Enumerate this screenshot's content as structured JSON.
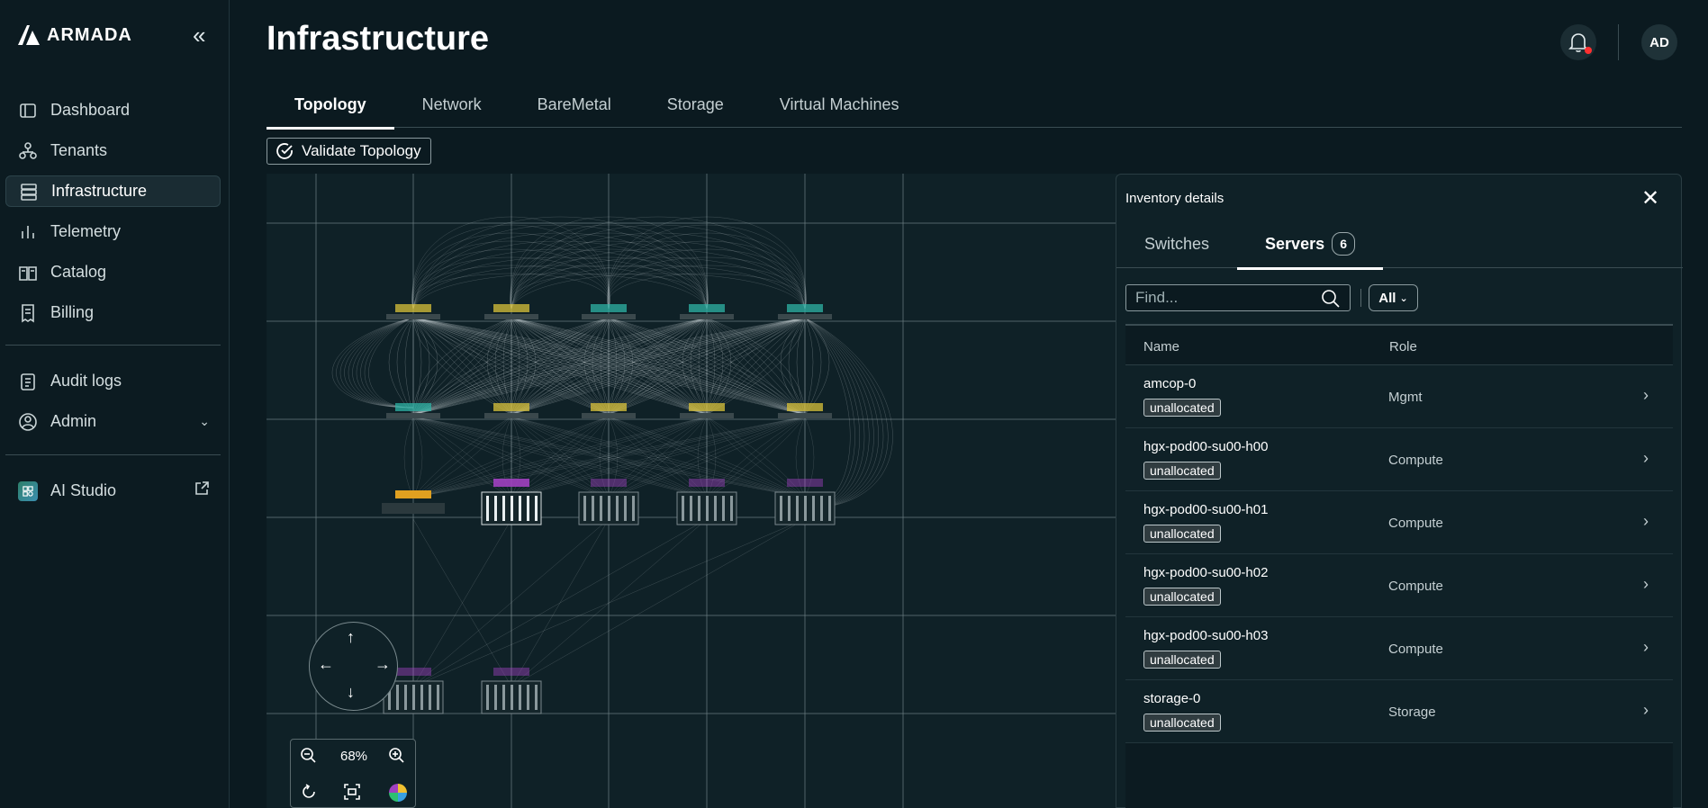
{
  "brand": {
    "name": "ARMADA",
    "collapse_icon": "double-chevron-left-icon"
  },
  "sidebar": {
    "items": [
      {
        "label": "Dashboard",
        "icon": "dashboard-icon",
        "active": false
      },
      {
        "label": "Tenants",
        "icon": "tenants-icon",
        "active": false
      },
      {
        "label": "Infrastructure",
        "icon": "server-stack-icon",
        "active": true
      },
      {
        "label": "Telemetry",
        "icon": "bar-chart-icon",
        "active": false
      },
      {
        "label": "Catalog",
        "icon": "book-icon",
        "active": false
      },
      {
        "label": "Billing",
        "icon": "receipt-icon",
        "active": false
      },
      {
        "label": "Audit logs",
        "icon": "clipboard-icon",
        "active": false
      },
      {
        "label": "Admin",
        "icon": "user-gear-icon",
        "active": false
      },
      {
        "label": "AI Studio",
        "icon": "ai-studio-icon",
        "active": false
      }
    ]
  },
  "header": {
    "title": "Infrastructure",
    "avatar_initials": "AD"
  },
  "tabs": [
    {
      "label": "Topology",
      "active": true
    },
    {
      "label": "Network",
      "active": false
    },
    {
      "label": "BareMetal",
      "active": false
    },
    {
      "label": "Storage",
      "active": false
    },
    {
      "label": "Virtual Machines",
      "active": false
    }
  ],
  "validate_button": {
    "label": "Validate Topology"
  },
  "zoom": {
    "level": "68%"
  },
  "panel": {
    "title": "Inventory details",
    "tabs": [
      {
        "label": "Switches",
        "active": false
      },
      {
        "label": "Servers",
        "active": true,
        "count": "6"
      }
    ],
    "search_placeholder": "Find...",
    "filter_value": "All",
    "columns": {
      "name": "Name",
      "role": "Role"
    },
    "rows": [
      {
        "name": "amcop-0",
        "status": "unallocated",
        "role": "Mgmt"
      },
      {
        "name": "hgx-pod00-su00-h00",
        "status": "unallocated",
        "role": "Compute"
      },
      {
        "name": "hgx-pod00-su00-h01",
        "status": "unallocated",
        "role": "Compute"
      },
      {
        "name": "hgx-pod00-su00-h02",
        "status": "unallocated",
        "role": "Compute"
      },
      {
        "name": "hgx-pod00-su00-h03",
        "status": "unallocated",
        "role": "Compute"
      },
      {
        "name": "storage-0",
        "status": "unallocated",
        "role": "Storage"
      }
    ]
  },
  "colors": {
    "background": "#0b1a20",
    "accent": "#ffffff",
    "alert": "#ff3030",
    "switch_yellow": "#d9c23a",
    "switch_teal": "#2fb3a6",
    "server_purple": "#a040c0"
  }
}
